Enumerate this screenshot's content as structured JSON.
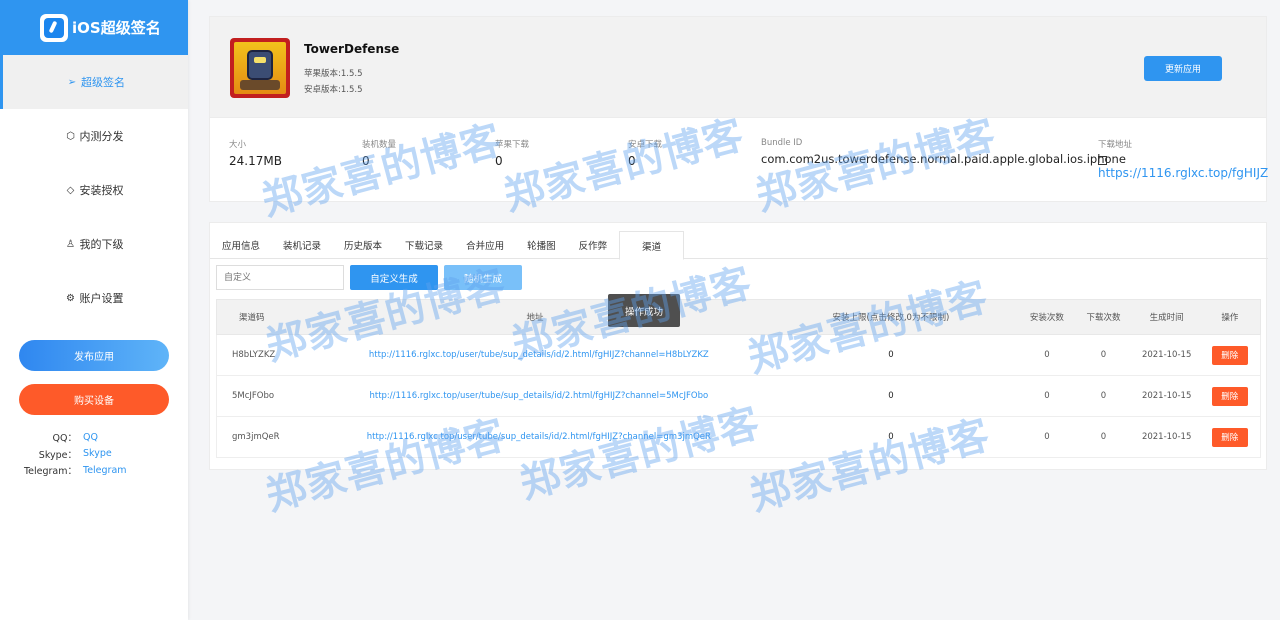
{
  "brand": {
    "title": "iOS超级签名"
  },
  "sidebar": {
    "items": [
      {
        "icon": "send-icon",
        "glyph": "➢",
        "label": "超级签名"
      },
      {
        "icon": "cube-icon",
        "glyph": "⬡",
        "label": "内测分发"
      },
      {
        "icon": "tag-icon",
        "glyph": "◇",
        "label": "安装授权"
      },
      {
        "icon": "user-icon",
        "glyph": "♙",
        "label": "我的下级"
      },
      {
        "icon": "gear-icon",
        "glyph": "⚙",
        "label": "账户设置"
      }
    ],
    "publish_label": "发布应用",
    "buy_label": "购买设备",
    "contacts": [
      {
        "key": "QQ：",
        "value": "QQ"
      },
      {
        "key": "Skype：",
        "value": "Skype"
      },
      {
        "key": "Telegram：",
        "value": "Telegram"
      }
    ]
  },
  "app": {
    "name": "TowerDefense",
    "ios_version": "苹果版本:1.5.5",
    "android_version": "安卓版本:1.5.5",
    "update_label": "更新应用"
  },
  "stats": {
    "size_label": "大小",
    "size": "24.17MB",
    "devices_label": "装机数量",
    "devices": "0",
    "apple_dl_label": "苹果下载",
    "apple_dl": "0",
    "android_dl_label": "安卓下载",
    "android_dl": "0",
    "bundle_label": "Bundle ID",
    "bundle": "com.com2us.towerdefense.normal.paid.apple.global.ios.iphone",
    "download_label": "下载地址",
    "download_url": "https://1116.rglxc.top/fgHIJZ"
  },
  "tabs": [
    "应用信息",
    "装机记录",
    "历史版本",
    "下载记录",
    "合并应用",
    "轮播图",
    "反作弊",
    "渠道"
  ],
  "active_tab": "渠道",
  "channel": {
    "input_placeholder": "自定义",
    "custom_gen_label": "自定义生成",
    "random_gen_label": "随机生成",
    "headers": {
      "code": "渠道码",
      "address": "地址",
      "cap": "安装上限(点击修改,0为不限制)",
      "installs": "安装次数",
      "downloads": "下载次数",
      "created": "生成时间",
      "action": "操作"
    },
    "rows": [
      {
        "code": "H8bLYZKZ",
        "address": "http://1116.rglxc.top/user/tube/sup_details/id/2.html/fgHIJZ?channel=H8bLYZKZ",
        "cap": "0",
        "installs": "0",
        "downloads": "0",
        "created": "2021-10-15",
        "action": "删除"
      },
      {
        "code": "5McJFObo",
        "address": "http://1116.rglxc.top/user/tube/sup_details/id/2.html/fgHIJZ?channel=5McJFObo",
        "cap": "0",
        "installs": "0",
        "downloads": "0",
        "created": "2021-10-15",
        "action": "删除"
      },
      {
        "code": "gm3jmQeR",
        "address": "http://1116.rglxc.top/user/tube/sup_details/id/2.html/fgHIJZ?channel=gm3jmQeR",
        "cap": "0",
        "installs": "0",
        "downloads": "0",
        "created": "2021-10-15",
        "action": "删除"
      }
    ]
  },
  "toast": "操作成功",
  "watermark": "郑家喜的博客",
  "colors": {
    "primary": "#2f95f0",
    "danger": "#fe5a29",
    "sidebar_header": "#2f95f0"
  }
}
